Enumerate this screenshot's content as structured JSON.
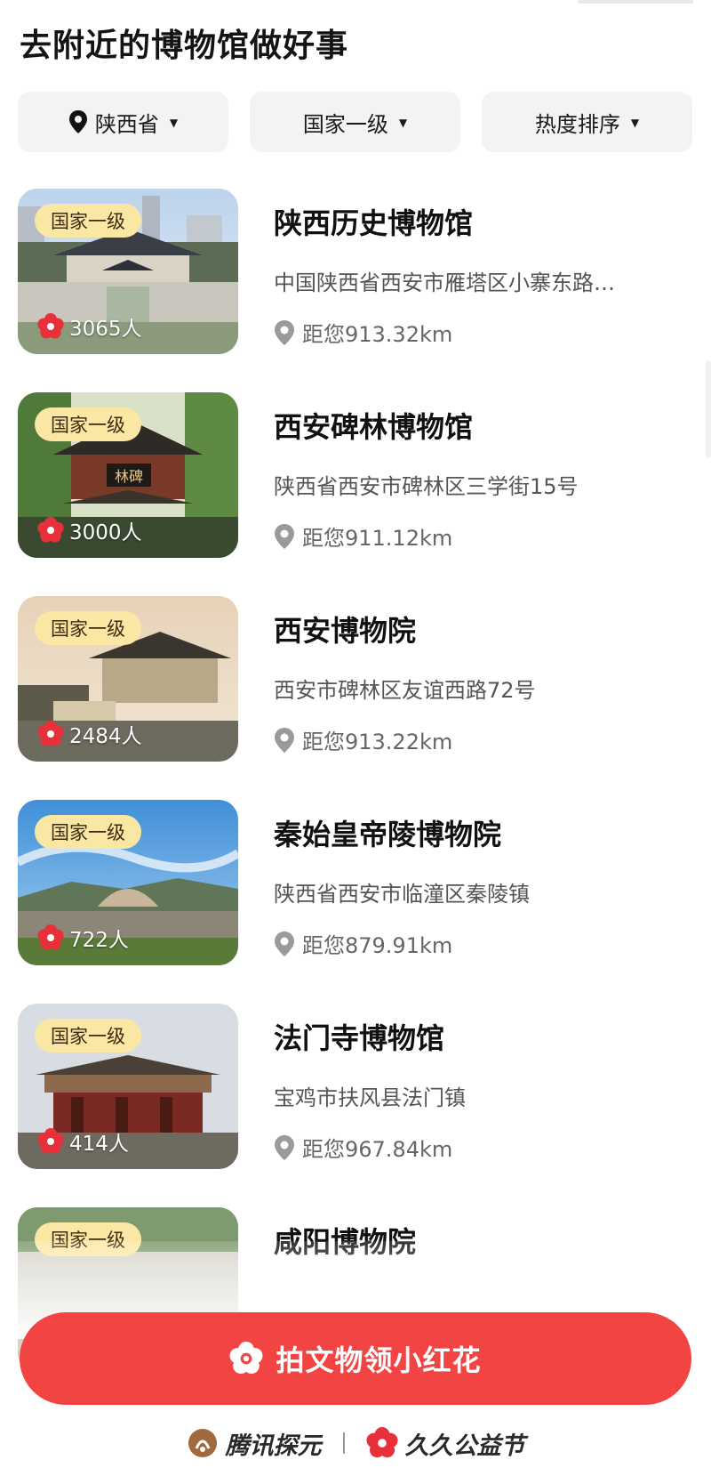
{
  "page": {
    "title": "去附近的博物馆做好事"
  },
  "filters": [
    {
      "label": "陕西省",
      "icon": "location-pin-icon"
    },
    {
      "label": "国家一级"
    },
    {
      "label": "热度排序"
    }
  ],
  "museums": [
    {
      "name": "陕西历史博物馆",
      "badge": "国家一级",
      "count": "3065人",
      "address": "中国陕西省西安市雁塔区小寨东路…",
      "distance": "距您913.32km"
    },
    {
      "name": "西安碑林博物馆",
      "badge": "国家一级",
      "count": "3000人",
      "address": "陕西省西安市碑林区三学街15号",
      "distance": "距您911.12km"
    },
    {
      "name": "西安博物院",
      "badge": "国家一级",
      "count": "2484人",
      "address": "西安市碑林区友谊西路72号",
      "distance": "距您913.22km"
    },
    {
      "name": "秦始皇帝陵博物院",
      "badge": "国家一级",
      "count": "722人",
      "address": "陕西省西安市临潼区秦陵镇",
      "distance": "距您879.91km"
    },
    {
      "name": "法门寺博物馆",
      "badge": "国家一级",
      "count": "414人",
      "address": "宝鸡市扶风县法门镇",
      "distance": "距您967.84km"
    },
    {
      "name": "咸阳博物院",
      "badge": "国家一级"
    }
  ],
  "cta": {
    "label": "拍文物领小红花",
    "icon": "red-flower-icon"
  },
  "footer": {
    "brand_left": "腾讯探元",
    "brand_right": "久久公益节"
  },
  "colors": {
    "accent": "#f24443",
    "badge_bg": "#fbe7a4",
    "filter_bg": "#f3f3f3"
  }
}
